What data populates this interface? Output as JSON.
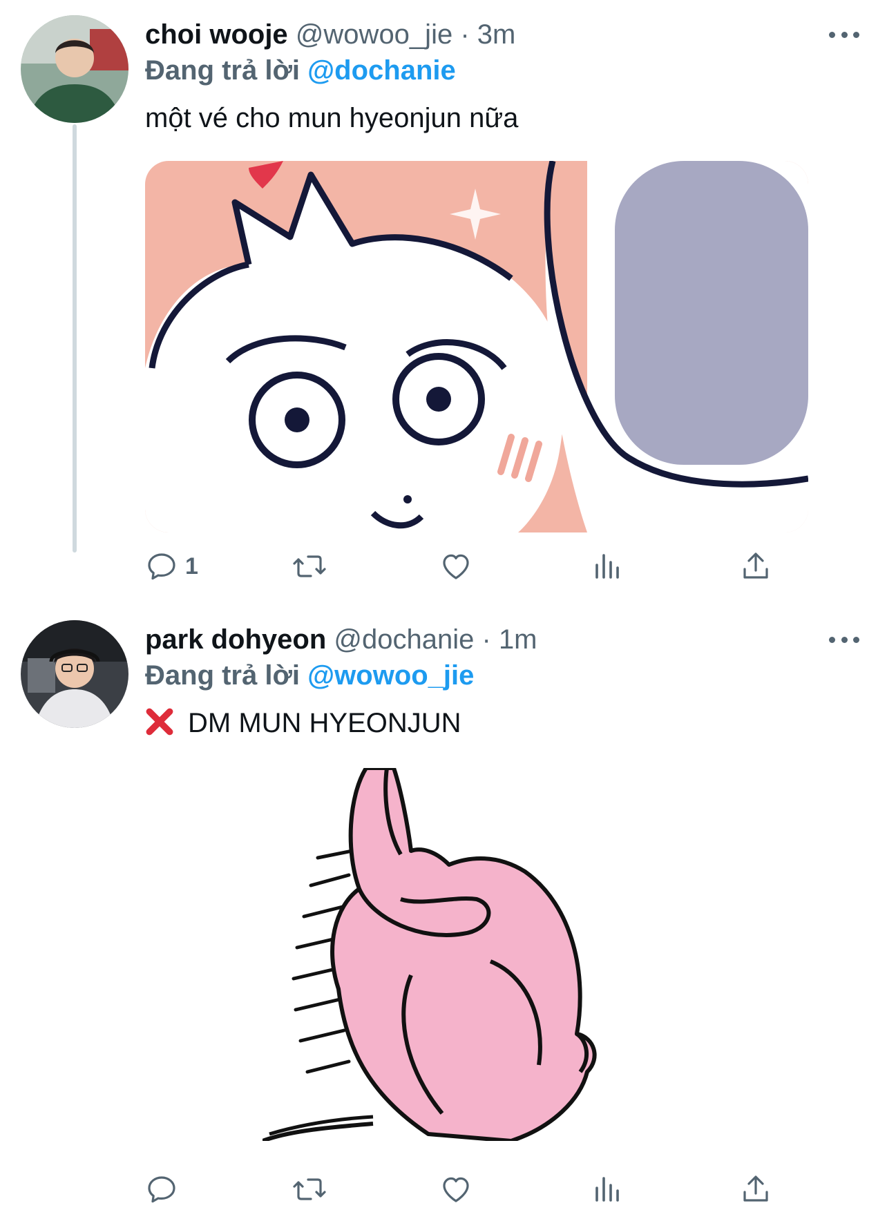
{
  "tweets": [
    {
      "name": "choi wooje",
      "handle": "@wowoo_jie",
      "separator": "·",
      "time": "3m",
      "replying_prefix": "Đang trả lời",
      "replying_to": "@dochanie",
      "text": "một vé cho mun hyeonjun nữa",
      "reply_count": "1",
      "avatar_icon": "user-photo-avatar",
      "media_description_icon": "white-cat-sticker"
    },
    {
      "name": "park dohyeon",
      "handle": "@dochanie",
      "separator": "·",
      "time": "1m",
      "replying_prefix": "Đang trả lời",
      "replying_to": "@wowoo_jie",
      "text": "DM MUN HYEONJUN",
      "reply_count": "",
      "avatar_icon": "user-photo-avatar",
      "media_description_icon": "pink-rabbit-sticker"
    }
  ],
  "colors": {
    "accent": "#1d9bf0",
    "secondary_text": "#536471",
    "primary_text": "#0f1419",
    "thread_line": "#cfd9de"
  },
  "icons": {
    "reply": "reply-icon",
    "retweet": "retweet-icon",
    "like": "heart-icon",
    "views": "views-icon",
    "share": "share-icon",
    "more": "more-icon",
    "cross": "cross-mark-icon"
  }
}
